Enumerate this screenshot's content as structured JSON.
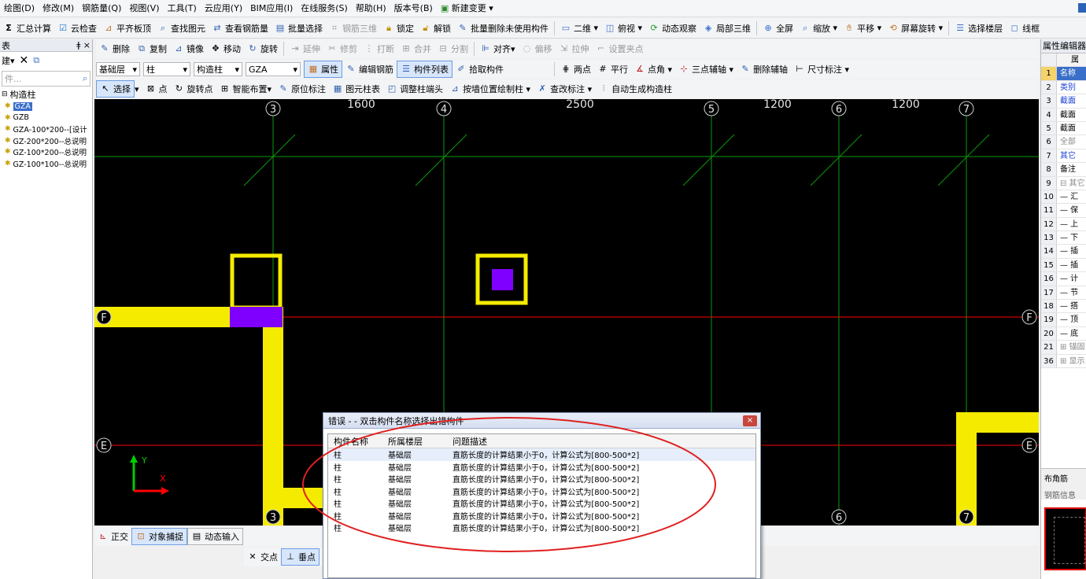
{
  "menu": [
    "绘图(D)",
    "修改(M)",
    "钢筋量(Q)",
    "视图(V)",
    "工具(T)",
    "云应用(Y)",
    "BIM应用(I)",
    "在线服务(S)",
    "帮助(H)",
    "版本号(B)",
    "新建变更"
  ],
  "toolbar1": [
    "汇总计算",
    "云检查",
    "平齐板顶",
    "查找图元",
    "查看钢筋量",
    "批量选择",
    "钢筋三维",
    "锁定",
    "解锁",
    "批量删除未使用构件",
    "二维",
    "俯视",
    "动态观察",
    "局部三维",
    "全屏",
    "缩放",
    "平移",
    "屏幕旋转",
    "选择楼层",
    "线框"
  ],
  "left_panel": {
    "title": "表",
    "pin": "ǂ ×",
    "new_label": "建",
    "search_placeholder": "件...",
    "tree_root": "构造柱",
    "items": [
      "GZA",
      "GZB",
      "GZA-100*200--[设计",
      "GZ-200*200--总说明",
      "GZ-100*200--总说明",
      "GZ-100*100--总说明"
    ]
  },
  "toolbar2": {
    "floor": "基础层",
    "category": "柱",
    "type": "构造柱",
    "component": "GZA",
    "buttons": [
      "属性",
      "编辑钢筋",
      "构件列表",
      "拾取构件",
      "两点",
      "平行",
      "点角",
      "三点辅轴",
      "删除辅轴",
      "尺寸标注"
    ]
  },
  "toolbar3": [
    "删除",
    "复制",
    "镜像",
    "移动",
    "旋转",
    "延伸",
    "修剪",
    "打断",
    "合并",
    "分割",
    "对齐",
    "偏移",
    "拉伸",
    "设置夹点"
  ],
  "toolbar4": [
    "选择",
    "点",
    "旋转点",
    "智能布置",
    "原位标注",
    "图元柱表",
    "调整柱端头",
    "按墙位置绘制柱",
    "查改标注",
    "自动生成构造柱"
  ],
  "canvas": {
    "axis_top": [
      "3",
      "4",
      "5",
      "6",
      "7"
    ],
    "axis_bottom": [
      "3",
      "6",
      "7"
    ],
    "axis_rows": [
      "F",
      "E"
    ],
    "dims": [
      "1600",
      "2500",
      "1200",
      "1200"
    ],
    "ucs_y": "Y",
    "ucs_x": "X"
  },
  "statusbar": [
    "正交",
    "对象捕捉",
    "动态输入"
  ],
  "statusbar2": [
    "交点",
    "垂点"
  ],
  "right_panel": {
    "title": "属性编辑器",
    "col_header": "属",
    "rows": [
      {
        "n": "1",
        "t": "名称"
      },
      {
        "n": "2",
        "t": "类别"
      },
      {
        "n": "3",
        "t": "截面"
      },
      {
        "n": "4",
        "t": "截面"
      },
      {
        "n": "5",
        "t": "截面"
      },
      {
        "n": "6",
        "t": "全部"
      },
      {
        "n": "7",
        "t": "其它"
      },
      {
        "n": "8",
        "t": "备注"
      },
      {
        "n": "9",
        "t": "⊟ 其它"
      },
      {
        "n": "10",
        "t": "— 汇"
      },
      {
        "n": "11",
        "t": "— 保"
      },
      {
        "n": "12",
        "t": "— 上"
      },
      {
        "n": "13",
        "t": "— 下"
      },
      {
        "n": "14",
        "t": "— 插"
      },
      {
        "n": "15",
        "t": "— 插"
      },
      {
        "n": "16",
        "t": "— 计"
      },
      {
        "n": "17",
        "t": "— 节"
      },
      {
        "n": "18",
        "t": "— 搭"
      },
      {
        "n": "19",
        "t": "— 顶"
      },
      {
        "n": "20",
        "t": "— 底"
      },
      {
        "n": "21",
        "t": "⊞ 锚固"
      },
      {
        "n": "36",
        "t": "⊞ 显示"
      }
    ],
    "tab1": "布角筋",
    "tab2": "钢筋信息"
  },
  "dialog": {
    "title": "错误 - - 双击构件名称选择出错构件",
    "close": "×",
    "headers": [
      "构件名称",
      "所属楼层",
      "问题描述"
    ],
    "rows": [
      {
        "name": "柱",
        "floor": "基础层",
        "desc": "直筋长度的计算结果小于0，计算公式为[800-500*2]"
      },
      {
        "name": "柱",
        "floor": "基础层",
        "desc": "直筋长度的计算结果小于0，计算公式为[800-500*2]"
      },
      {
        "name": "柱",
        "floor": "基础层",
        "desc": "直筋长度的计算结果小于0，计算公式为[800-500*2]"
      },
      {
        "name": "柱",
        "floor": "基础层",
        "desc": "直筋长度的计算结果小于0，计算公式为[800-500*2]"
      },
      {
        "name": "柱",
        "floor": "基础层",
        "desc": "直筋长度的计算结果小于0，计算公式为[800-500*2]"
      },
      {
        "name": "柱",
        "floor": "基础层",
        "desc": "直筋长度的计算结果小于0，计算公式为[800-500*2]"
      },
      {
        "name": "柱",
        "floor": "基础层",
        "desc": "直筋长度的计算结果小于0，计算公式为[800-500*2]"
      }
    ]
  },
  "colors": {
    "wall": "#f5eb00",
    "column": "#8000ff",
    "grid": "#00aa00",
    "axis_red": "#ff0000",
    "annotation": "#e02020"
  }
}
